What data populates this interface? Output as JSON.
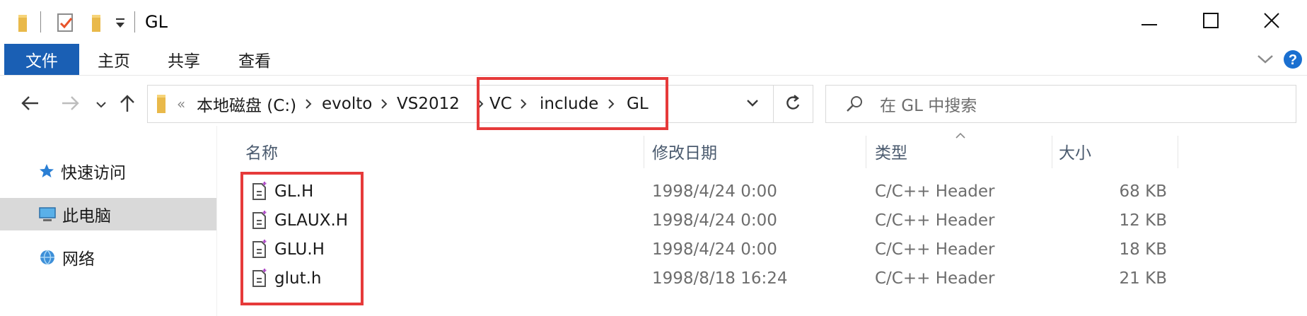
{
  "window": {
    "title": "GL",
    "controls": [
      "minimize-icon",
      "maximize-icon",
      "close-icon"
    ]
  },
  "ribbon": {
    "file_tab": "文件",
    "tabs": [
      "主页",
      "共享",
      "查看"
    ]
  },
  "address": {
    "overflow": "«",
    "crumbs": [
      "本地磁盘 (C:)",
      "evolto",
      "VS2012",
      "VC",
      "include",
      "GL"
    ]
  },
  "search": {
    "placeholder": "在 GL 中搜索"
  },
  "nav_pane": {
    "items": [
      {
        "label": "快速访问",
        "icon": "star-icon",
        "selected": false
      },
      {
        "label": "此电脑",
        "icon": "computer-icon",
        "selected": true
      },
      {
        "label": "网络",
        "icon": "network-icon",
        "selected": false
      }
    ]
  },
  "columns": {
    "name": "名称",
    "modified": "修改日期",
    "type": "类型",
    "size": "大小"
  },
  "files": [
    {
      "name": "GL.H",
      "modified": "1998/4/24 0:00",
      "type": "C/C++ Header",
      "size": "68 KB"
    },
    {
      "name": "GLAUX.H",
      "modified": "1998/4/24 0:00",
      "type": "C/C++ Header",
      "size": "12 KB"
    },
    {
      "name": "GLU.H",
      "modified": "1998/4/24 0:00",
      "type": "C/C++ Header",
      "size": "18 KB"
    },
    {
      "name": "glut.h",
      "modified": "1998/8/18 16:24",
      "type": "C/C++ Header",
      "size": "21 KB"
    }
  ],
  "colors": {
    "accent": "#1a5fb4",
    "highlight": "#e63a3a",
    "help": "#1a6fd0"
  }
}
